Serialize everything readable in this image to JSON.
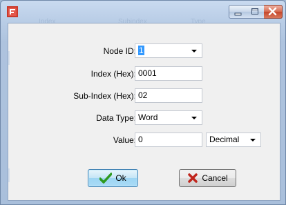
{
  "window": {
    "background_ghost_text": [
      "Index",
      "Subindex",
      "Type"
    ]
  },
  "form": {
    "node_id": {
      "label": "Node ID:",
      "value": "1"
    },
    "index": {
      "label": "Index (Hex):",
      "value": "0001"
    },
    "sub_index": {
      "label": "Sub-Index (Hex):",
      "value": "02"
    },
    "data_type": {
      "label": "Data Type:",
      "value": "Word"
    },
    "value": {
      "label": "Value:",
      "value": "0",
      "format": "Decimal"
    }
  },
  "buttons": {
    "ok": "Ok",
    "cancel": "Cancel"
  },
  "colors": {
    "ok_check": "#2e9a1f",
    "cancel_x": "#c0251c",
    "selection": "#3399ff"
  }
}
